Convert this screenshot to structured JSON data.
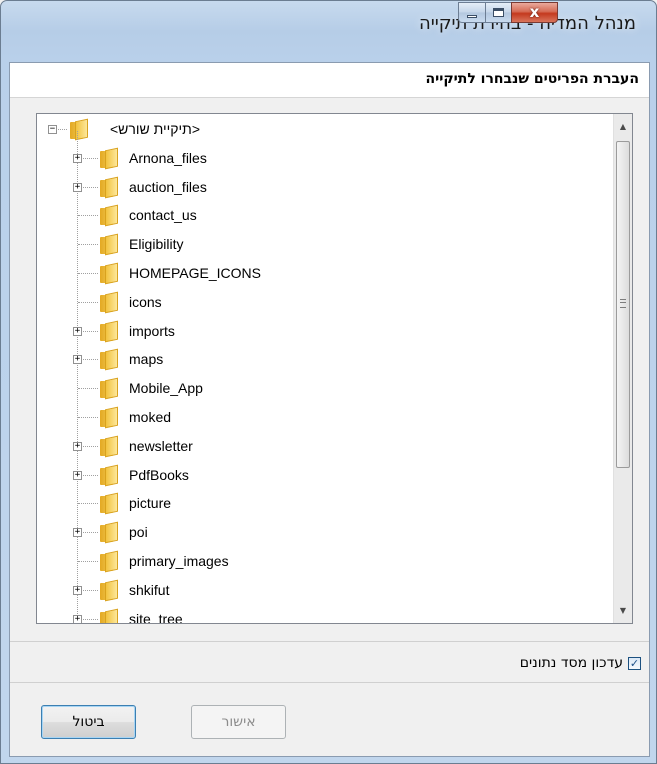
{
  "window": {
    "title": "מנהל המדיה - בחירת תיקייה",
    "close_glyph": "x"
  },
  "dialog": {
    "header": "העברת הפריטים שנבחרו לתיקייה"
  },
  "tree": {
    "root": {
      "label": "<תיקיית שורש>",
      "expander": "−"
    },
    "items": [
      {
        "label": "Arnona_files",
        "has_children": true
      },
      {
        "label": "auction_files",
        "has_children": true
      },
      {
        "label": "contact_us",
        "has_children": false
      },
      {
        "label": "Eligibility",
        "has_children": false
      },
      {
        "label": "HOMEPAGE_ICONS",
        "has_children": false
      },
      {
        "label": "icons",
        "has_children": false
      },
      {
        "label": "imports",
        "has_children": true
      },
      {
        "label": "maps",
        "has_children": true
      },
      {
        "label": "Mobile_App",
        "has_children": false
      },
      {
        "label": "moked",
        "has_children": false
      },
      {
        "label": "newsletter",
        "has_children": true
      },
      {
        "label": "PdfBooks",
        "has_children": true
      },
      {
        "label": "picture",
        "has_children": false
      },
      {
        "label": "poi",
        "has_children": true
      },
      {
        "label": "primary_images",
        "has_children": false
      },
      {
        "label": "shkifut",
        "has_children": true
      },
      {
        "label": "site_tree",
        "has_children": true
      }
    ],
    "expand_glyph": "+",
    "scroll_up": "▲",
    "scroll_down": "▼"
  },
  "options": {
    "update_db_label": "עדכון מסד נתונים",
    "update_db_checked": true,
    "check_glyph": "✓"
  },
  "buttons": {
    "ok": "אישור",
    "cancel": "ביטול"
  }
}
